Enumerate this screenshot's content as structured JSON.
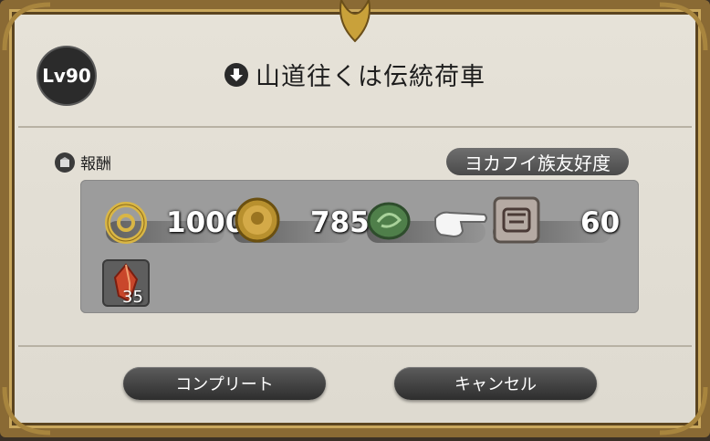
{
  "level_badge": "Lv90",
  "quest_title": "山道往くは伝統荷車",
  "rewards_label": "報酬",
  "tribe_pill": "ヨカフイ族友好度",
  "rewards": {
    "gil": "1000",
    "tomestone": "785",
    "reputation": "60",
    "crystal_count": "35"
  },
  "buttons": {
    "complete": "コンプリート",
    "cancel": "キャンセル"
  },
  "colors": {
    "frame": "#8a6a34",
    "panel": "#e6e2d8",
    "reward_box": "#9c9c9c"
  }
}
